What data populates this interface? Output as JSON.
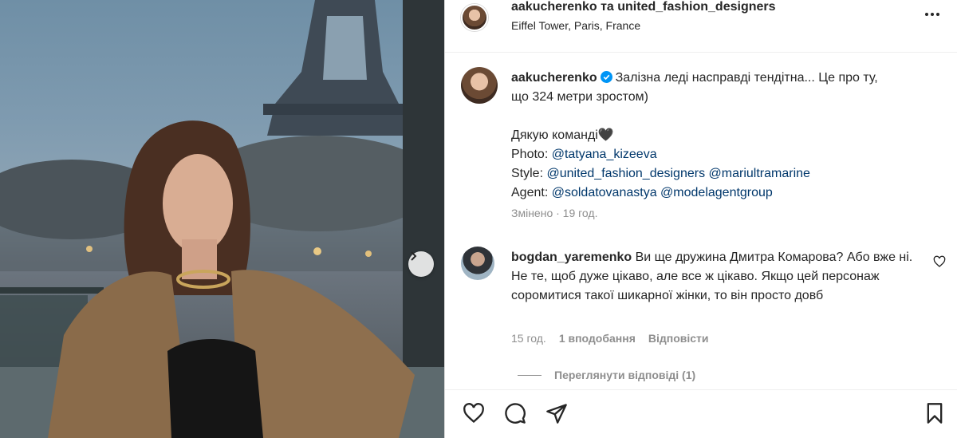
{
  "post": {
    "header": {
      "username": "aakucherenko",
      "connector": "та",
      "collaborator": "united_fashion_designers",
      "location": "Eiffel Tower, Paris, France"
    },
    "caption": {
      "username": "aakucherenko",
      "line1": "Залізна леді насправді тендітна... Це про ту,",
      "line2": "що 324 метри зростом)",
      "thanks": "Дякую команді🖤",
      "photo_label": "Photo:",
      "photo_mention": "@tatyana_kizeeva",
      "style_label": "Style:",
      "style_mention_1": "@united_fashion_designers",
      "style_mention_2": "@mariultramarine",
      "agent_label": "Agent:",
      "agent_mention_1": "@soldatovanastya",
      "agent_mention_2": "@modelagentgroup",
      "edited": "Змінено · 19 год."
    },
    "comment": {
      "username": "bogdan_yaremenko",
      "text": "Ви ще дружина Дмитра Комарова? Або вже ні. Не те, щоб дуже цікаво, але все ж цікаво. Якщо цей персонаж соромитися такої шикарної жінки, то він просто довб",
      "time": "15 год.",
      "likes": "1 вподобання",
      "reply": "Відповісти",
      "view_replies": "Переглянути відповіді (1)"
    },
    "actions": [
      "heart-icon",
      "comment-icon",
      "share-icon",
      "bookmark-icon"
    ],
    "colors": {
      "mention": "#00376b",
      "verified": "#0095f6",
      "muted": "#8e8e8e"
    }
  }
}
